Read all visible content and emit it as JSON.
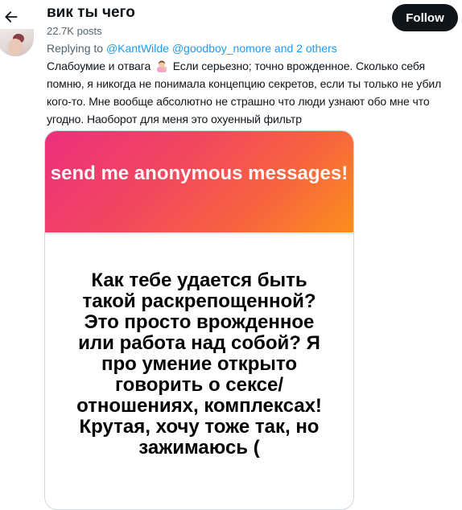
{
  "header": {
    "back_icon": "arrow-left-icon",
    "profile_name": "вик ты чего",
    "post_count": "22.7K posts",
    "follow_label": "Follow"
  },
  "reply": {
    "prefix": "Replying to ",
    "mentions": "@KantWilde @goodboy_nomore and 2 others"
  },
  "post": {
    "text_before_emoji": "Слабоумие и отвага",
    "emoji": "woman-tipping-hand-emoji",
    "text_after_emoji": " Если серьезно; точно врожденное. Сколько себя помню, я никогда не понимала концепцию секретов, если ты только не убил кого-то. Мне вообще абсолютно не страшно что люди узнают обо мне что угодно. Наоборот для меня это охуенный фильтр"
  },
  "media": {
    "header_text": "send me anonymous messages!",
    "question": "Как тебе удается быть такой раскрепощенной? Это просто врожденное или работа над собой? Я про умение открыто говорить о сексе/ отношениях, комплексах! Крутая, хочу тоже так, но зажимаюсь ("
  },
  "colors": {
    "link": "#1d9bf0",
    "secondary_text": "#536471",
    "follow_bg": "#0f1419",
    "gradient_start": "#ec2f7c",
    "gradient_end": "#fb8f1d"
  }
}
